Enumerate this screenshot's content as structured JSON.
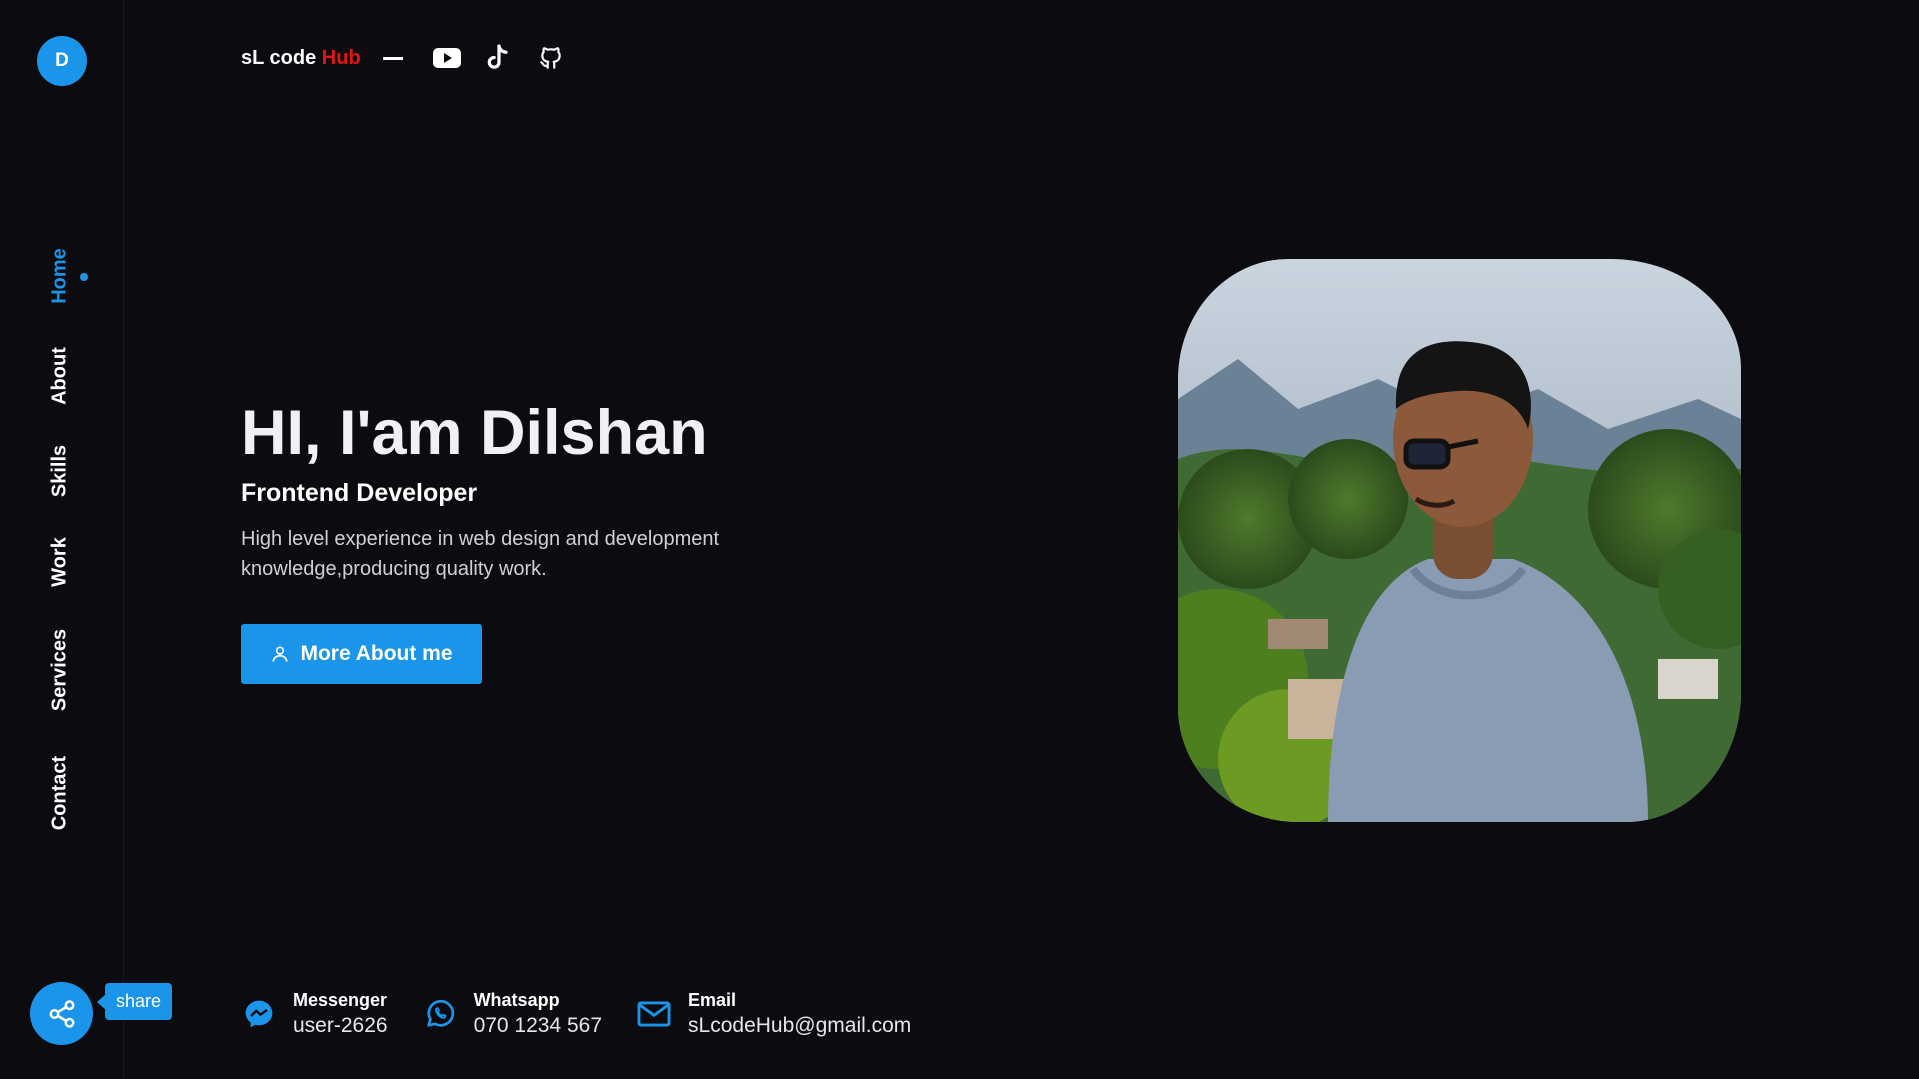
{
  "sidebar": {
    "logo_letter": "D",
    "nav": [
      {
        "label": "Home",
        "active": true
      },
      {
        "label": "About"
      },
      {
        "label": "Skills"
      },
      {
        "label": "Work"
      },
      {
        "label": "Services"
      },
      {
        "label": "Contact"
      }
    ],
    "share_tooltip": "share"
  },
  "header": {
    "brand_prefix": "sL code ",
    "brand_accent": "Hub",
    "social_icons": [
      "youtube-icon",
      "tiktok-icon",
      "github-icon"
    ]
  },
  "hero": {
    "title": "HI, I'am Dilshan",
    "subtitle": "Frontend Developer",
    "description": "High level experience in web design and development knowledge,producing quality work.",
    "button_label": "More About me"
  },
  "contacts": [
    {
      "icon": "messenger-icon",
      "label": "Messenger",
      "value": "user-2626"
    },
    {
      "icon": "whatsapp-icon",
      "label": "Whatsapp",
      "value": "070 1234 567"
    },
    {
      "icon": "email-icon",
      "label": "Email",
      "value": "sLcodeHub@gmail.com"
    }
  ],
  "colors": {
    "accent": "#1b95ea",
    "brand_red": "#e31414",
    "background": "#0b0b10"
  }
}
